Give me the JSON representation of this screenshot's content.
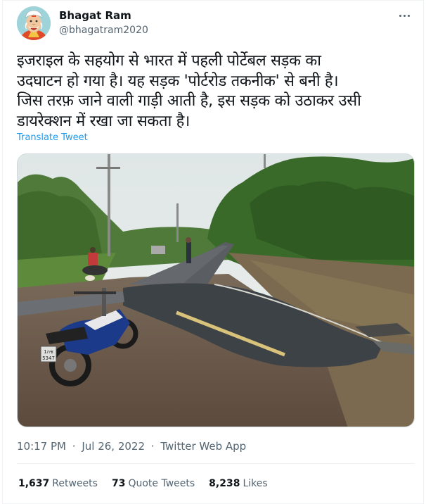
{
  "user": {
    "name": "Bhagat Ram",
    "handle": "@bhagatram2020"
  },
  "tweet": {
    "text": "इजराइल के सहयोग से भारत में पहली पोर्टेबल सड़क का\nउदघाटन हो गया है। यह सड़क 'पोर्टरोड तकनीक' से बनी है।\nजिस तरफ़ जाने वाली गाड़ी आती है, इस सड़क को उठाकर उसी\nडायरेक्शन में रखा जा सकता है।",
    "translate_label": "Translate Tweet",
    "time": "10:17 PM",
    "date": "Jul 26, 2022",
    "source": "Twitter Web App",
    "separator": "·"
  },
  "stats": {
    "retweets_count": "1,637",
    "retweets_label": "Retweets",
    "quotes_count": "73",
    "quotes_label": "Quote Tweets",
    "likes_count": "8,238",
    "likes_label": "Likes"
  },
  "photo": {
    "plate_text": "1กช\n5347"
  },
  "colors": {
    "link": "#1d9bf0",
    "secondary": "#536471",
    "primary_text": "#0f1419",
    "border": "#eff3f4"
  },
  "icons": [
    "avatar-cartoon",
    "more-options-icon"
  ]
}
